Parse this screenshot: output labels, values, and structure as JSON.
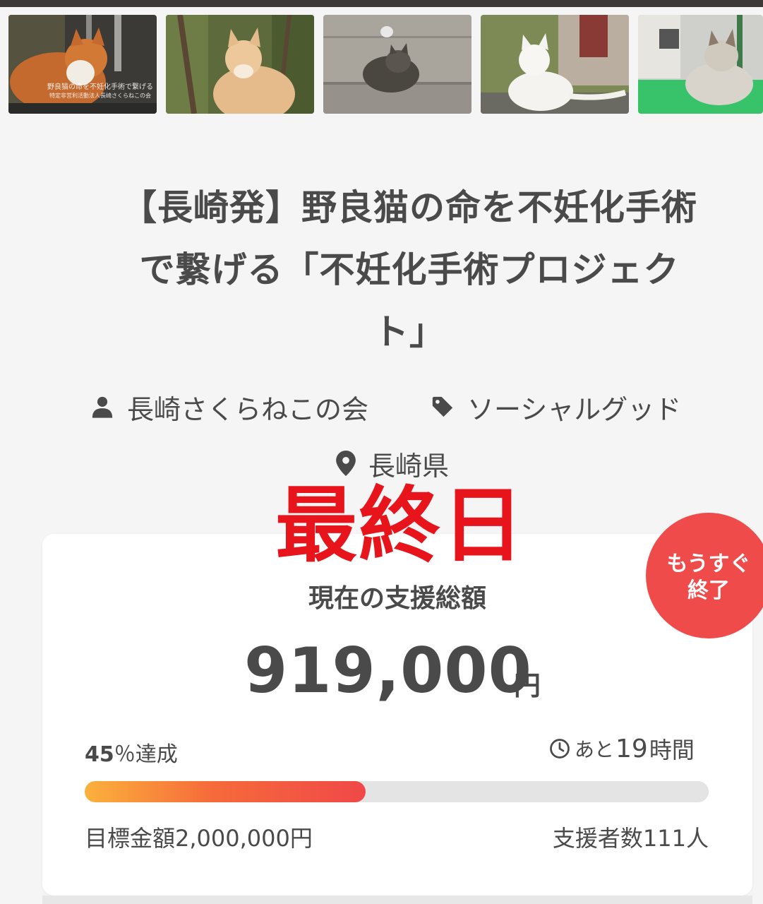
{
  "gallery": {
    "items": [
      {
        "name": "cat-photo-1",
        "caption_line1": "野良猫の命を不妊化手術で繋げる",
        "caption_line2": "特定非営利活動法人長崎さくらねこの会"
      },
      {
        "name": "cat-photo-2"
      },
      {
        "name": "cat-photo-3"
      },
      {
        "name": "cat-photo-4"
      },
      {
        "name": "cat-photo-5"
      }
    ]
  },
  "project": {
    "title_line1": "【長崎発】野良猫の命を不妊化手術",
    "title_line2": "で繋げる「不妊化手術プロジェク",
    "title_line3": "ト」",
    "owner": "長崎さくらねこの会",
    "category": "ソーシャルグッド",
    "location": "長崎県"
  },
  "overlay": {
    "final_day": "最終日"
  },
  "funding": {
    "label": "現在の支援総額",
    "amount": "919,000",
    "currency": "円",
    "percent_num": "45",
    "percent_suffix": "％達成",
    "progress": 0.45,
    "remaining_prefix": "あと",
    "remaining_hours": "19",
    "remaining_unit": "時間",
    "goal": "目標金額2,000,000円",
    "backers": "支援者数111人"
  },
  "badge": {
    "line1": "もうすぐ",
    "line2": "終了",
    "color": "#ef4b4b"
  },
  "colors": {
    "accent_red": "#e8141b",
    "progress_start": "#fbb13c",
    "progress_end": "#f04848"
  },
  "icons": [
    "user-icon",
    "tag-icon",
    "location-pin-icon",
    "clock-icon"
  ]
}
